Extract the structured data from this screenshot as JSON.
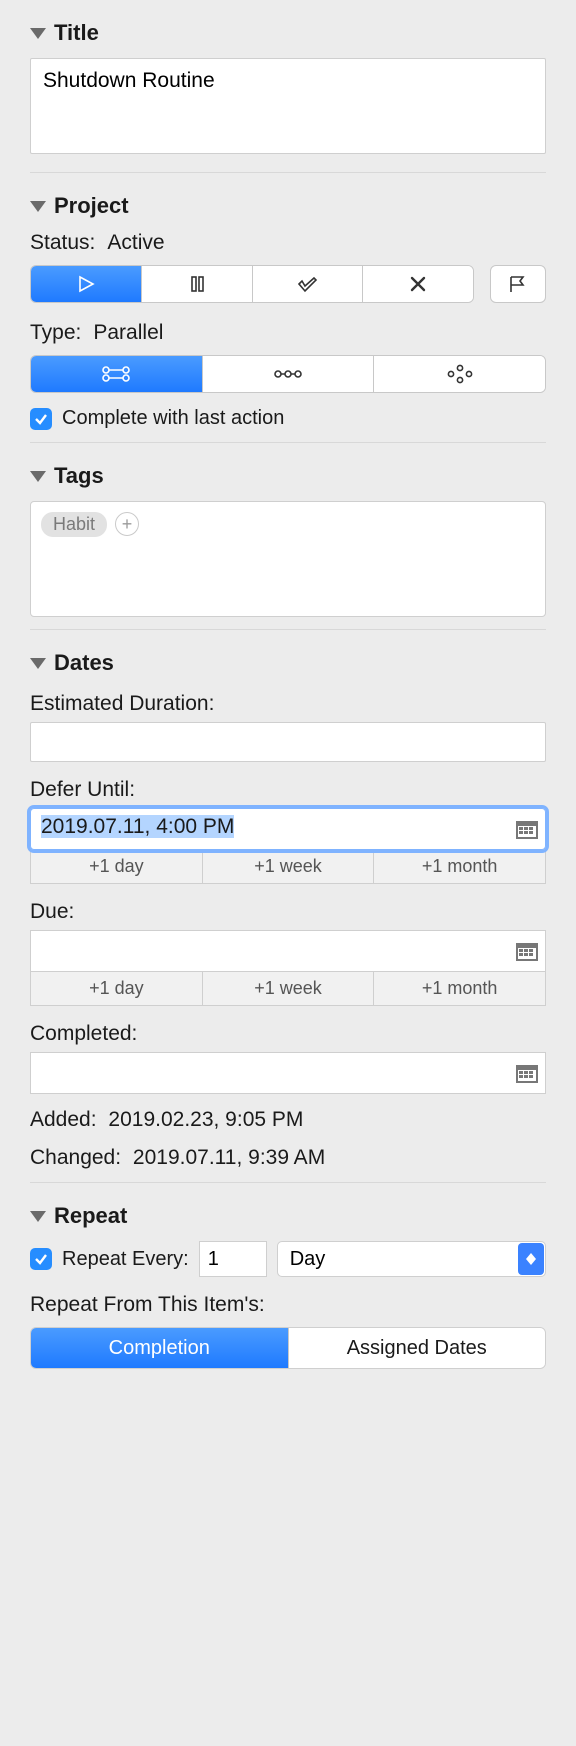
{
  "sections": {
    "title": {
      "header": "Title",
      "value": "Shutdown Routine"
    },
    "project": {
      "header": "Project",
      "status_label": "Status:",
      "status_value": "Active",
      "type_label": "Type:",
      "type_value": "Parallel",
      "complete_last_label": "Complete with last action",
      "complete_last_checked": true
    },
    "tags": {
      "header": "Tags",
      "items": [
        "Habit"
      ]
    },
    "dates": {
      "header": "Dates",
      "estimated_label": "Estimated Duration:",
      "estimated_value": "",
      "defer_label": "Defer Until:",
      "defer_value": "2019.07.11, 4:00 PM",
      "due_label": "Due:",
      "due_value": "",
      "completed_label": "Completed:",
      "completed_value": "",
      "quick": {
        "day": "+1 day",
        "week": "+1 week",
        "month": "+1 month"
      },
      "added_label": "Added:",
      "added_value": "2019.02.23, 9:05 PM",
      "changed_label": "Changed:",
      "changed_value": "2019.07.11, 9:39 AM"
    },
    "repeat": {
      "header": "Repeat",
      "every_label": "Repeat Every:",
      "every_value": "1",
      "every_unit": "Day",
      "every_checked": true,
      "from_label": "Repeat From This Item's:",
      "from_options": [
        "Completion",
        "Assigned Dates"
      ],
      "from_selected": "Completion"
    }
  }
}
